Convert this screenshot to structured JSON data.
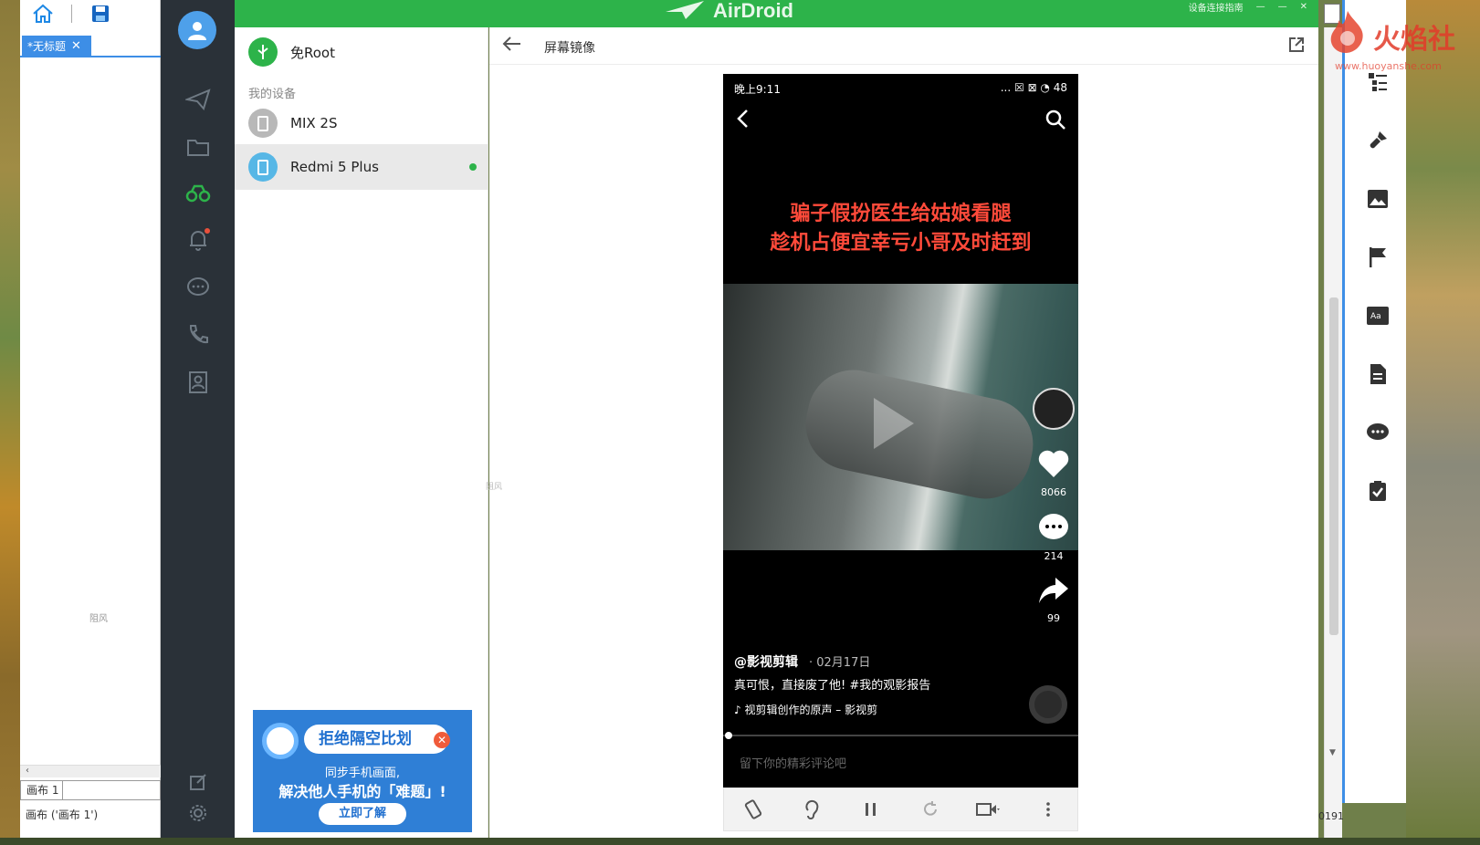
{
  "editor": {
    "tab_label": "*无标题",
    "tab_close": "✕",
    "canvas_hint": "阻风",
    "page_label": "画布 1",
    "status_text": "画布 ('画布 1')"
  },
  "airdroid": {
    "brand": "AirDroid",
    "title_right": "设备连接指南",
    "no_root_label": "免Root",
    "my_devices_label": "我的设备",
    "devices": [
      {
        "name": "MIX 2S",
        "color": "#b8b8b8",
        "online": false
      },
      {
        "name": "Redmi 5 Plus",
        "color": "#57b7e6",
        "online": true
      }
    ],
    "mirror_title": "屏幕镜像",
    "cut_hint": "阻风",
    "banner": {
      "title": "拒绝隔空比划",
      "line1": "同步手机画面,",
      "line2": "解决他人手机的「难题」!",
      "cta": "立即了解"
    }
  },
  "phone": {
    "time": "晚上9:11",
    "status_right": "... ☒ ⊠ ◔ 48",
    "caption_line1": "骗子假扮医生给姑娘看腿",
    "caption_line2": "趁机占便宜幸亏小哥及时赶到",
    "likes": "8066",
    "comments": "214",
    "shares": "99",
    "author": "@影视剪辑",
    "date": "· 02月17日",
    "description": "真可恨，直接废了他! #我的观影报告",
    "music": "视剪辑创作的原声 – 影视剪",
    "comment_placeholder": "留下你的精彩评论吧"
  },
  "right_panel": {
    "zoom_readout": "0191",
    "watermark_text": "火焰社",
    "watermark_url": "www.huoyanshe.com"
  },
  "colors": {
    "airdroid_green": "#2db34a",
    "sidebar_dark": "#2a3138",
    "accent_blue": "#3d8ee6",
    "caption_red": "#ff4a3a"
  }
}
